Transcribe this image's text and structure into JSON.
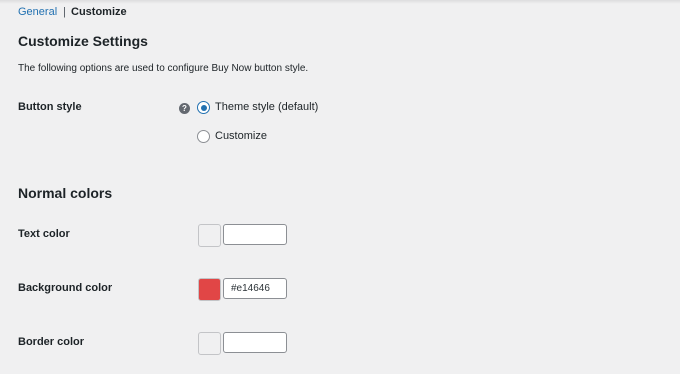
{
  "subnav": {
    "general": "General",
    "separator": "|",
    "current": "Customize"
  },
  "section": {
    "title": "Customize Settings",
    "description": "The following options are used to configure Buy Now button style."
  },
  "button_style": {
    "label": "Button style",
    "help_icon": "question-circle-icon",
    "help_glyph": "?",
    "options": [
      {
        "label": "Theme style (default)",
        "checked": true
      },
      {
        "label": "Customize",
        "checked": false
      }
    ]
  },
  "normal_colors": {
    "title": "Normal colors",
    "text_color": {
      "label": "Text color",
      "value": "",
      "swatch": "#f0f0f1"
    },
    "background_color": {
      "label": "Background color",
      "value": "#e14646",
      "swatch": "#e14646"
    },
    "border_color": {
      "label": "Border color",
      "value": "",
      "swatch": "#f0f0f1"
    }
  },
  "colors": {
    "accent": "#2271b1",
    "text": "#1d2327",
    "background": "#f0f0f1"
  }
}
